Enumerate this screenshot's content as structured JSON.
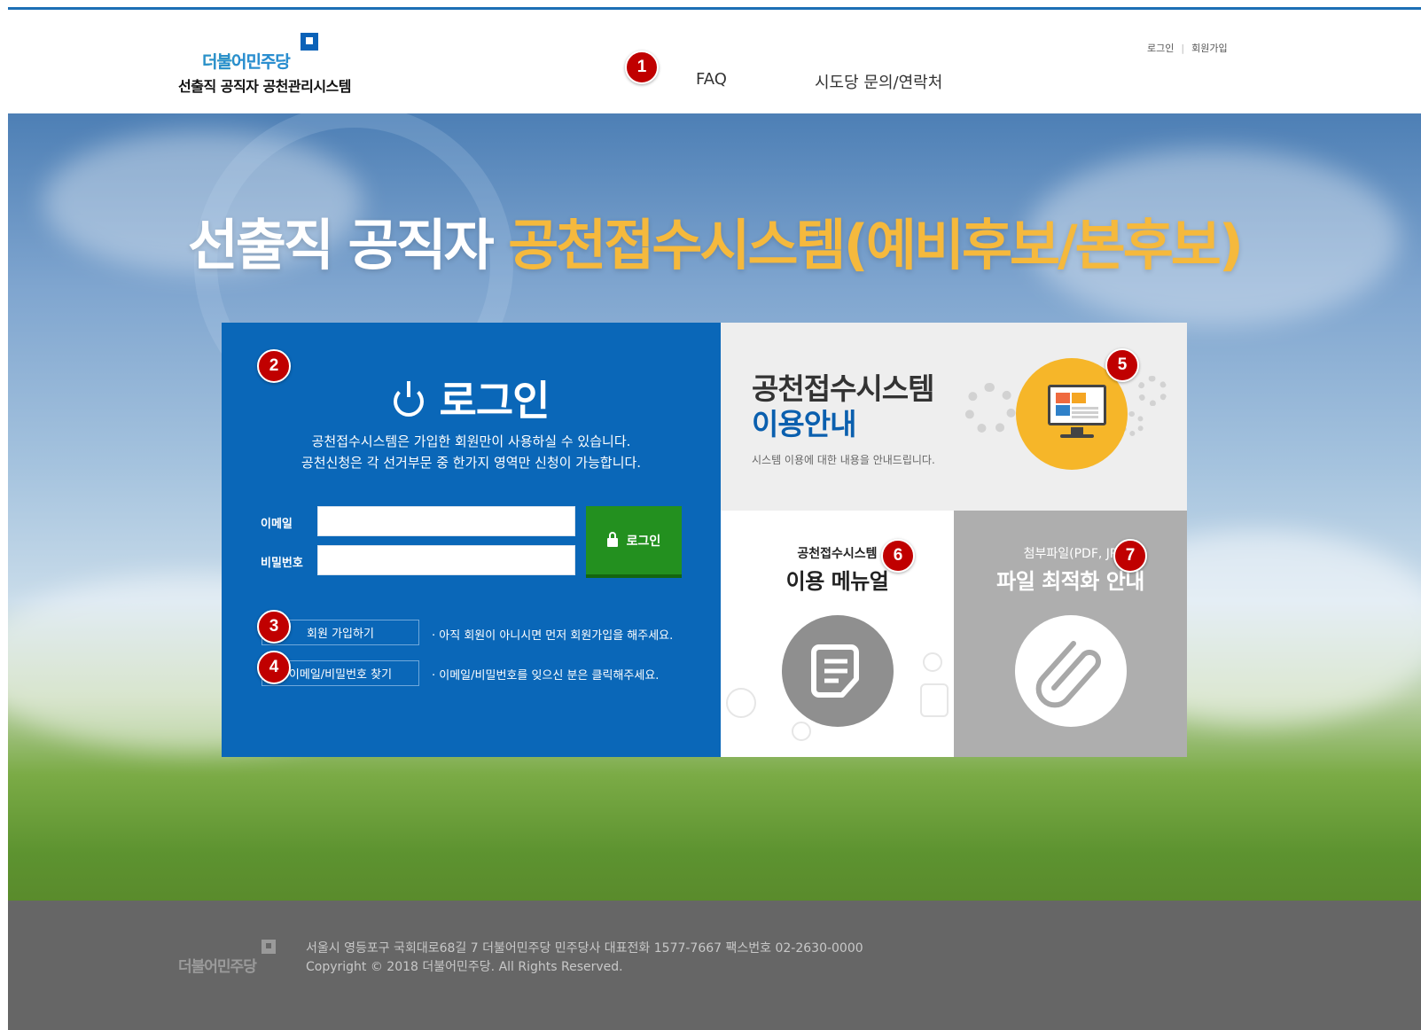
{
  "header": {
    "logo_party": "더불어민주당",
    "logo_subtitle": "선출직 공직자 공천관리시스템",
    "nav": {
      "faq": "FAQ",
      "contact": "시도당 문의/연락처"
    },
    "util": {
      "login": "로그인",
      "separator": "|",
      "signup": "회원가입"
    }
  },
  "hero": {
    "title_white": "선출직 공직자 ",
    "title_highlight": "공천접수시스템(예비후보/본후보)"
  },
  "login_panel": {
    "title": "로그인",
    "desc_line1": "공천접수시스템은 가입한 회원만이 사용하실 수 있습니다.",
    "desc_line2": "공천신청은 각 선거부문 중 한가지 영역만 신청이 가능합니다.",
    "email_label": "이메일",
    "email_value": "",
    "password_label": "비밀번호",
    "password_value": "",
    "login_button": "로그인",
    "signup_button": "회원 가입하기",
    "signup_hint": "· 아직 회원이 아니시면 먼저 회원가입을 해주세요.",
    "find_button": "이메일/비밀번호 찾기",
    "find_hint": "· 이메일/비밀번호를 잊으신 분은 클릭해주세요."
  },
  "cards": {
    "guide": {
      "line1": "공천접수시스템",
      "line2": "이용안내",
      "subtitle": "시스템 이용에 대한 내용을 안내드립니다."
    },
    "manual": {
      "small": "공천접수시스템",
      "big": "이용 메뉴얼"
    },
    "file": {
      "small": "첨부파일(PDF, JP",
      "big": "파일 최적화 안내"
    }
  },
  "badges": [
    "1",
    "2",
    "3",
    "4",
    "5",
    "6",
    "7"
  ],
  "footer": {
    "logo": "더불어민주당",
    "address": "서울시 영등포구 국회대로68길 7 더불어민주당 민주당사 대표전화 1577-7667 팩스번호 02-2630-0000",
    "copyright": "Copyright © 2018 더불어민주당. All Rights Reserved."
  },
  "colors": {
    "brand_blue": "#0a67b8",
    "login_green": "#23901f",
    "highlight_yellow": "#f5b93d",
    "badge_red": "#c00000",
    "footer_gray": "#666666"
  },
  "icons": [
    "power-icon",
    "lock-icon",
    "monitor-icon",
    "gear-icon",
    "document-icon",
    "paperclip-icon"
  ]
}
